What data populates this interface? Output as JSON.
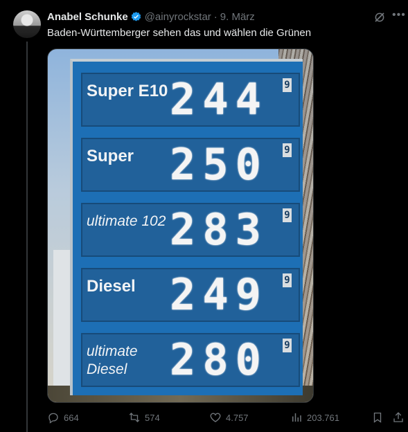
{
  "tweet": {
    "author_name": "Anabel Schunke",
    "handle": "@ainyrockstar",
    "separator": "·",
    "date": "9. März",
    "text": "Baden-Württemberger sehen das und wählen die Grünen"
  },
  "image": {
    "prices": [
      {
        "label": "Super E10",
        "value": "244",
        "tenths": "9"
      },
      {
        "label": "Super",
        "value": "250",
        "tenths": "9"
      },
      {
        "label": "ultimate 102",
        "value": "283",
        "tenths": "9"
      },
      {
        "label": "Diesel",
        "value": "249",
        "tenths": "9"
      },
      {
        "label": "ultimate Diesel",
        "value": "280",
        "tenths": "9"
      }
    ]
  },
  "actions": {
    "replies": "664",
    "reposts": "574",
    "likes": "4.757",
    "views": "203.761"
  },
  "colors": {
    "verified": "#1d9bf0",
    "muted": "#71767b",
    "background": "#000000"
  },
  "icons": [
    "verified-badge-icon",
    "grok-icon",
    "more-icon",
    "reply-icon",
    "repost-icon",
    "like-icon",
    "views-icon",
    "bookmark-icon",
    "share-icon"
  ]
}
